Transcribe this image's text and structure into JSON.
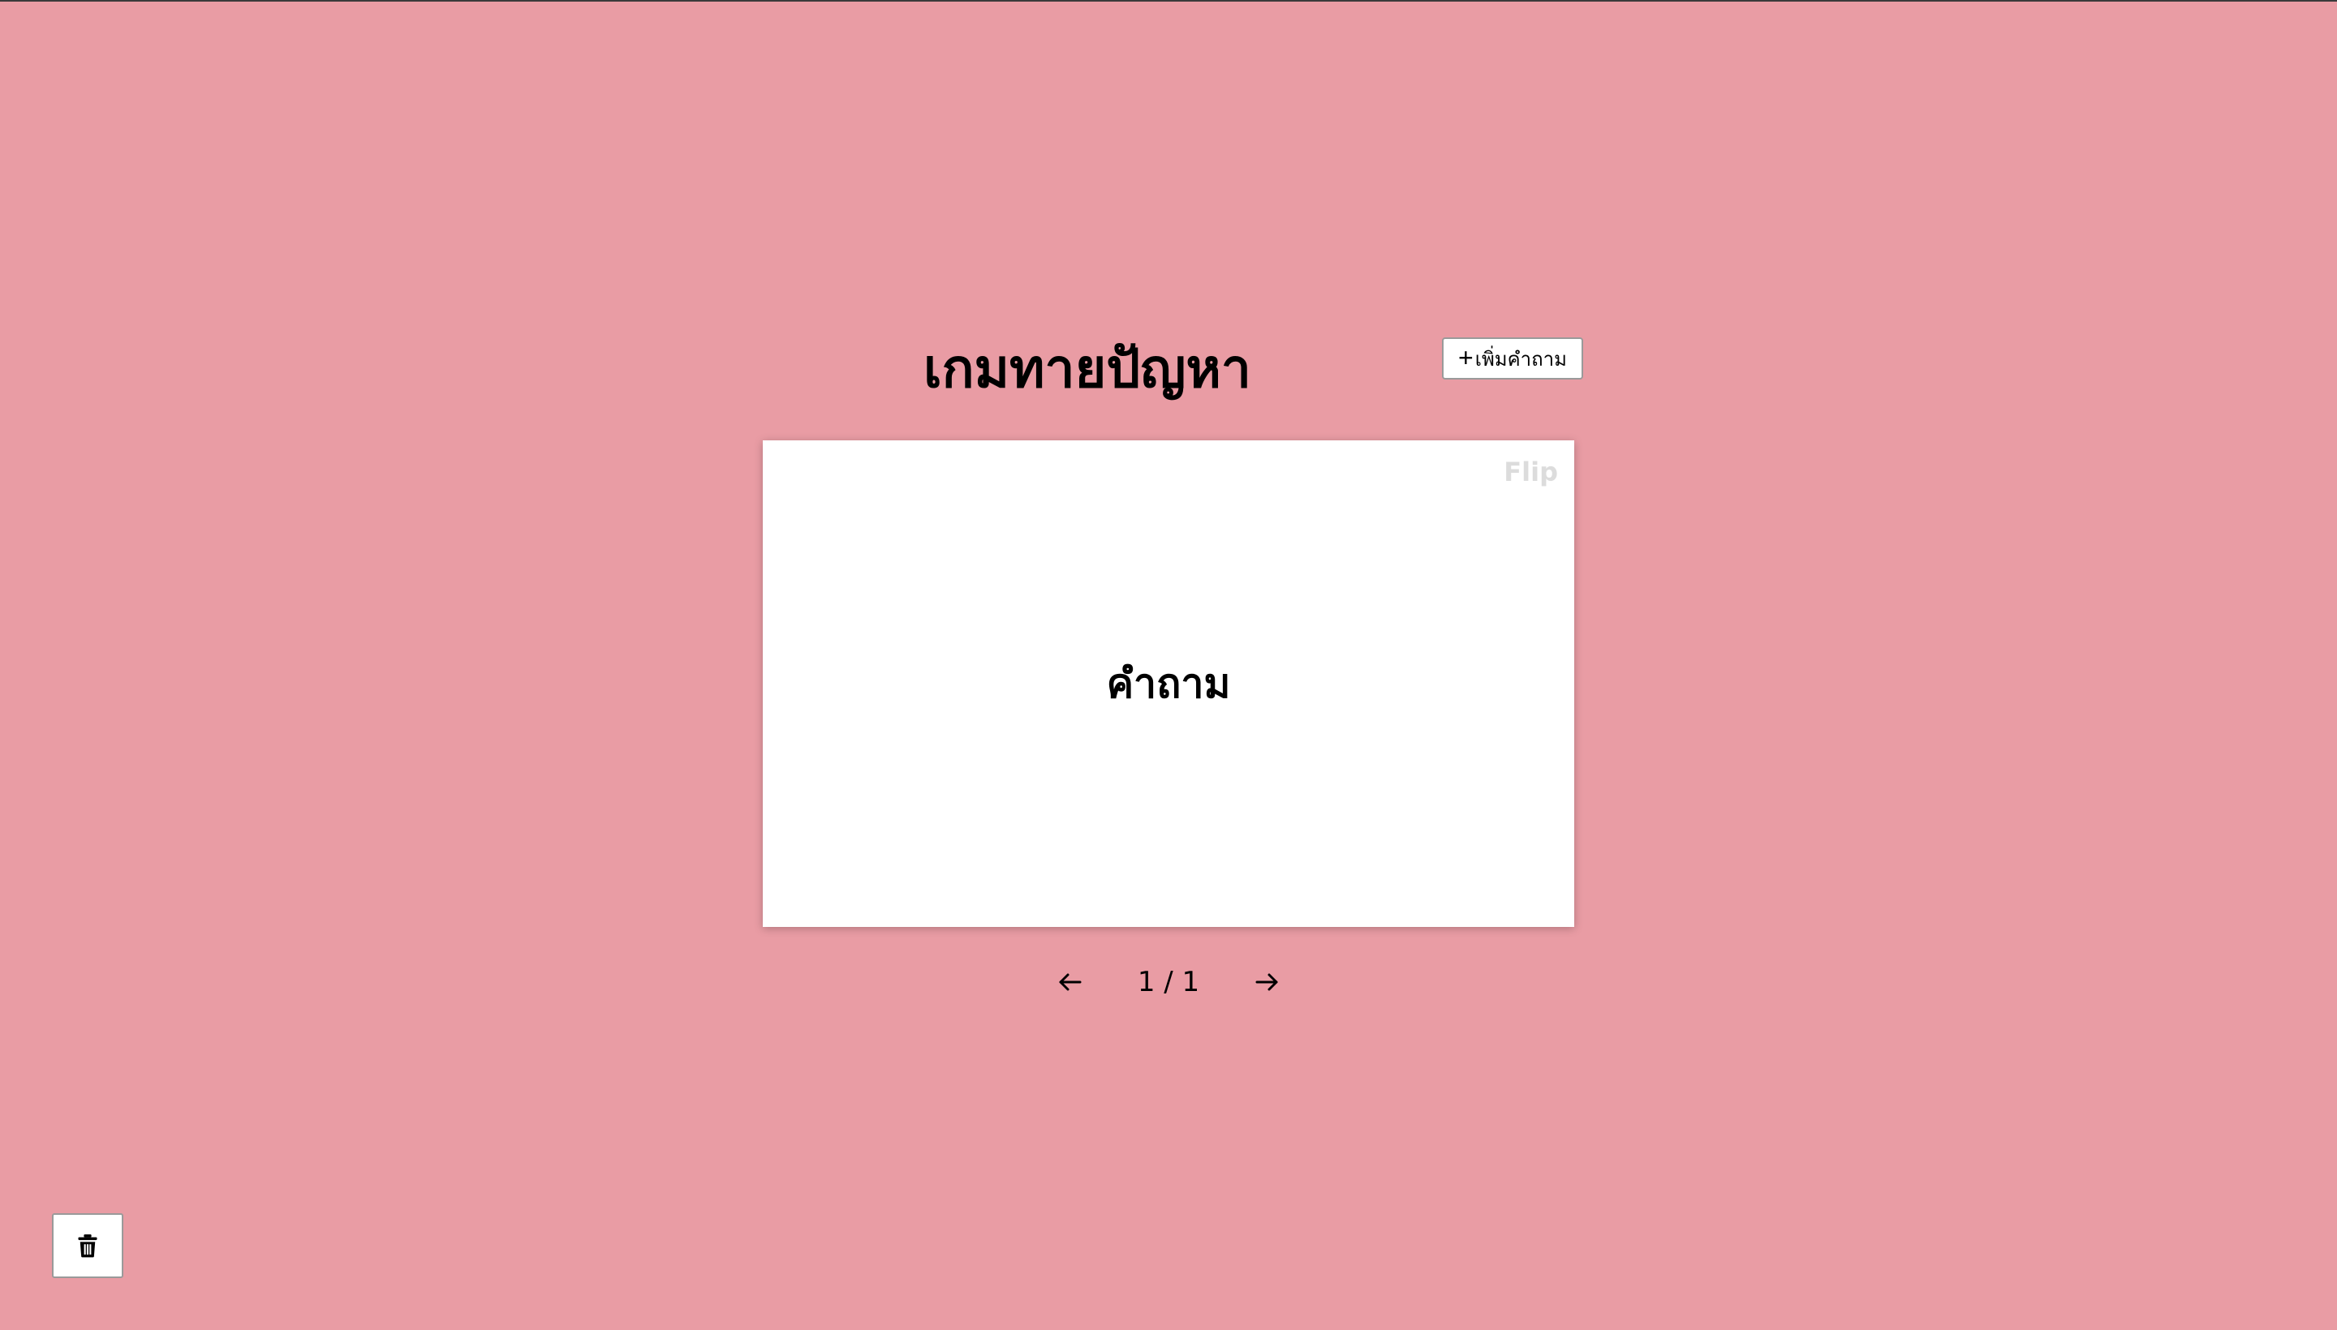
{
  "header": {
    "title": "เกมทายปัญหา",
    "add_button_icon": "plus-icon",
    "add_button_label": "เพิ่มคำถาม"
  },
  "card": {
    "flip_label": "Flip",
    "text": "คำถาม"
  },
  "navigation": {
    "prev_icon": "arrow-left-icon",
    "counter": "1 / 1",
    "next_icon": "arrow-right-icon"
  },
  "footer": {
    "delete_icon": "trash-icon"
  },
  "colors": {
    "background": "#e99ca4",
    "card_background": "#ffffff",
    "flip_label": "#dcdcdc"
  }
}
